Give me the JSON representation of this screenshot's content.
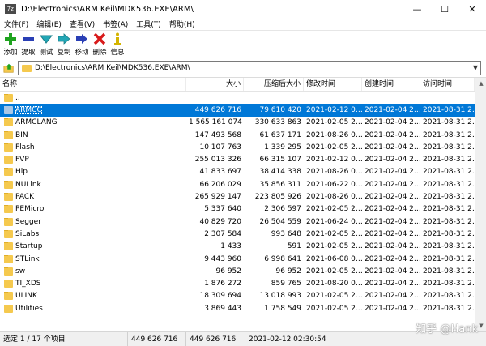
{
  "window": {
    "app_icon_text": "7z",
    "title": "D:\\Electronics\\ARM Keil\\MDK536.EXE\\ARM\\",
    "minimize": "—",
    "maximize": "☐",
    "close": "✕"
  },
  "menu": [
    "文件(F)",
    "编辑(E)",
    "查看(V)",
    "书签(A)",
    "工具(T)",
    "帮助(H)"
  ],
  "toolbar": {
    "add": "添加",
    "extract": "提取",
    "test": "测试",
    "copy": "复制",
    "move": "移动",
    "delete": "删除",
    "info": "信息"
  },
  "address": {
    "path": "D:\\Electronics\\ARM Keil\\MDK536.EXE\\ARM\\",
    "dropdown": "▼"
  },
  "columns": {
    "name": "名称",
    "size": "大小",
    "packed": "压缩后大小",
    "modified": "修改时间",
    "created": "创建时间",
    "accessed": "访问时间"
  },
  "parent_row": "..",
  "files": [
    {
      "name": "ARMCC",
      "size": "449 626 716",
      "packed": "79 610 420",
      "modified": "2021-02-12 0…",
      "created": "2021-02-04 2…",
      "accessed": "2021-08-31 2…",
      "selected": true
    },
    {
      "name": "ARMCLANG",
      "size": "1 565 161 074",
      "packed": "330 633 863",
      "modified": "2021-02-05 2…",
      "created": "2021-02-04 2…",
      "accessed": "2021-08-31 2…"
    },
    {
      "name": "BIN",
      "size": "147 493 568",
      "packed": "61 637 171",
      "modified": "2021-08-26 0…",
      "created": "2021-02-04 2…",
      "accessed": "2021-08-31 2…"
    },
    {
      "name": "Flash",
      "size": "10 107 763",
      "packed": "1 339 295",
      "modified": "2021-02-05 2…",
      "created": "2021-02-04 2…",
      "accessed": "2021-08-31 2…"
    },
    {
      "name": "FVP",
      "size": "255 013 326",
      "packed": "66 315 107",
      "modified": "2021-02-12 0…",
      "created": "2021-02-04 2…",
      "accessed": "2021-08-31 2…"
    },
    {
      "name": "Hlp",
      "size": "41 833 697",
      "packed": "38 414 338",
      "modified": "2021-08-26 0…",
      "created": "2021-02-04 2…",
      "accessed": "2021-08-31 2…"
    },
    {
      "name": "NULink",
      "size": "66 206 029",
      "packed": "35 856 311",
      "modified": "2021-06-22 0…",
      "created": "2021-02-04 2…",
      "accessed": "2021-08-31 2…"
    },
    {
      "name": "PACK",
      "size": "265 929 147",
      "packed": "223 805 926",
      "modified": "2021-08-26 0…",
      "created": "2021-02-04 2…",
      "accessed": "2021-08-31 2…"
    },
    {
      "name": "PEMicro",
      "size": "5 337 640",
      "packed": "2 306 597",
      "modified": "2021-02-05 2…",
      "created": "2021-02-04 2…",
      "accessed": "2021-08-31 2…"
    },
    {
      "name": "Segger",
      "size": "40 829 720",
      "packed": "26 504 559",
      "modified": "2021-06-24 0…",
      "created": "2021-02-04 2…",
      "accessed": "2021-08-31 2…"
    },
    {
      "name": "SiLabs",
      "size": "2 307 584",
      "packed": "993 648",
      "modified": "2021-02-05 2…",
      "created": "2021-02-04 2…",
      "accessed": "2021-08-31 2…"
    },
    {
      "name": "Startup",
      "size": "1 433",
      "packed": "591",
      "modified": "2021-02-05 2…",
      "created": "2021-02-04 2…",
      "accessed": "2021-08-31 2…"
    },
    {
      "name": "STLink",
      "size": "9 443 960",
      "packed": "6 998 641",
      "modified": "2021-06-08 0…",
      "created": "2021-02-04 2…",
      "accessed": "2021-08-31 2…"
    },
    {
      "name": "sw",
      "size": "96 952",
      "packed": "96 952",
      "modified": "2021-02-05 2…",
      "created": "2021-02-04 2…",
      "accessed": "2021-08-31 2…"
    },
    {
      "name": "TI_XDS",
      "size": "1 876 272",
      "packed": "859 765",
      "modified": "2021-08-20 0…",
      "created": "2021-02-04 2…",
      "accessed": "2021-08-31 2…"
    },
    {
      "name": "ULINK",
      "size": "18 309 694",
      "packed": "13 018 993",
      "modified": "2021-02-05 2…",
      "created": "2021-02-04 2…",
      "accessed": "2021-08-31 2…"
    },
    {
      "name": "Utilities",
      "size": "3 869 443",
      "packed": "1 758 549",
      "modified": "2021-02-05 2…",
      "created": "2021-02-04 2…",
      "accessed": "2021-08-31 2…"
    }
  ],
  "status": {
    "selection": "选定 1 / 17 个项目",
    "size": "449 626 716",
    "packed": "449 626 716",
    "datetime": "2021-02-12 02:30:54"
  },
  "watermark": "知乎 @Hank",
  "colors": {
    "selection": "#0078d7",
    "folder": "#f5c94e",
    "add_icon": "#1fa31f",
    "extract_icon": "#2a3fb5",
    "test_icon": "#22a6b5",
    "delete_icon": "#d81a1a",
    "info_icon": "#d4b400"
  }
}
